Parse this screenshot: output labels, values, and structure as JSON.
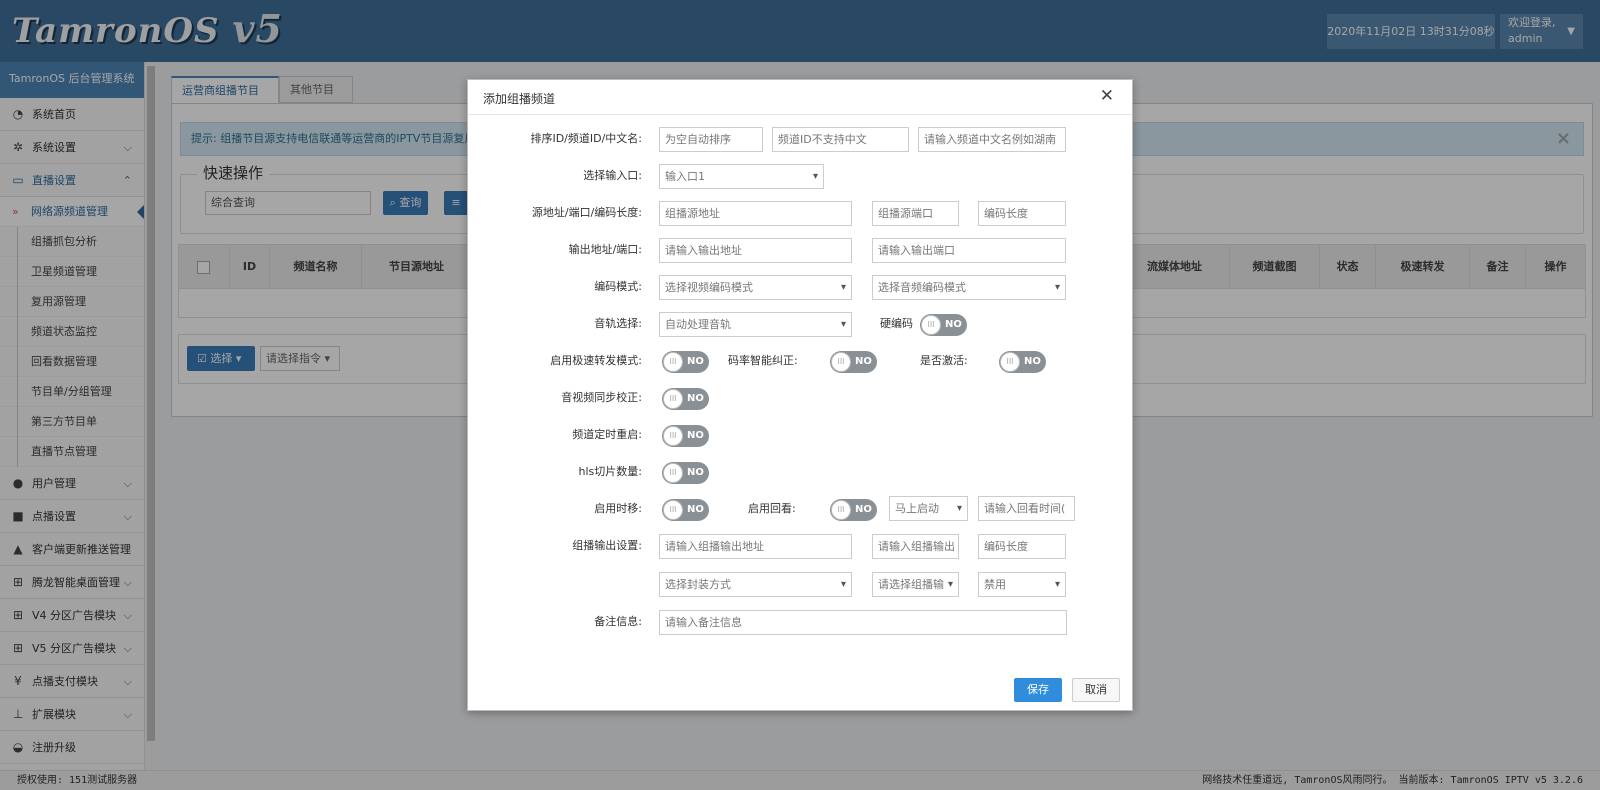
{
  "header": {
    "logo_text": "TamronOS",
    "logo_version": "v5",
    "datetime": "2020年11月02日 13时31分08秒",
    "welcome": "欢迎登录,",
    "username": "admin"
  },
  "sidebar": {
    "title": "TamronOS 后台管理系统",
    "items": [
      {
        "label": "系统首页",
        "icon": "dashboard-icon"
      },
      {
        "label": "系统设置",
        "icon": "gears-icon"
      },
      {
        "label": "直播设置",
        "icon": "monitor-icon"
      },
      {
        "label": "用户管理",
        "icon": "user-icon"
      },
      {
        "label": "点播设置",
        "icon": "video-camera-icon"
      },
      {
        "label": "客户端更新推送管理",
        "icon": "android-icon"
      },
      {
        "label": "腾龙智能桌面管理",
        "icon": "windows-icon"
      },
      {
        "label": "V4 分区广告模块",
        "icon": "windows-icon"
      },
      {
        "label": "V5 分区广告模块",
        "icon": "windows-icon"
      },
      {
        "label": "点播支付模块",
        "icon": "yen-icon"
      },
      {
        "label": "扩展模块",
        "icon": "sitemap-icon"
      },
      {
        "label": "注册升级",
        "icon": "tachometer-icon"
      }
    ],
    "subitems": [
      "网络源频道管理",
      "组播抓包分析",
      "卫星频道管理",
      "复用源管理",
      "频道状态监控",
      "回看数据管理",
      "节目单/分组管理",
      "第三方节目单",
      "直播节点管理"
    ]
  },
  "main": {
    "tabs": [
      "运营商组播节目源",
      "其他节目源"
    ],
    "tip": "提示: 组播节目源支持电信联通等运营商的IPTV节目源复用",
    "quick_title": "快速操作",
    "search_value": "综合查询",
    "search_btn": "查询",
    "table_headers_left": [
      "ID",
      "频道名称",
      "节目源地址"
    ],
    "table_headers_right": [
      "流媒体地址",
      "频道截图",
      "状态",
      "极速转发",
      "备注",
      "操作"
    ],
    "select_btn": "选择",
    "command_placeholder": "请选择指令"
  },
  "modal": {
    "title": "添加组播频道",
    "labels": {
      "sort": "排序ID/频道ID/中文名:",
      "input_port": "选择输入口:",
      "source": "源地址/端口/编码长度:",
      "output": "输出地址/端口:",
      "codec_mode": "编码模式:",
      "audio_track": "音轨选择:",
      "hard_codec": "硬编码",
      "fast_forward": "启用极速转发模式:",
      "bitrate_fix": "码率智能纠正:",
      "activate": "是否激活:",
      "av_sync": "音视频同步校正:",
      "timed_restart": "频道定时重启:",
      "hls_count": "hls切片数量:",
      "timeshift": "启用时移:",
      "playback": "启用回看:",
      "multicast_out": "组播输出设置:",
      "remark": "备注信息:"
    },
    "fields": {
      "sort_id": "为空自动排序",
      "channel_id": "频道ID不支持中文",
      "channel_name": "请输入频道中文名例如湖南",
      "input_port": "输入口1",
      "src_addr": "组播源地址",
      "src_port": "组播源端口",
      "src_codelen": "编码长度",
      "out_addr": "请输入输出地址",
      "out_port": "请输入输出端口",
      "video_codec": "选择视频编码模式",
      "audio_codec": "选择音频编码模式",
      "audio_track": "自动处理音轨",
      "playback_start": "马上启动",
      "playback_time": "请输入回看时间(",
      "mc_out_addr": "请输入组播输出地址",
      "mc_out_port": "请输入组播输出",
      "mc_codelen": "编码长度",
      "encap": "选择封装方式",
      "mc_select": "请选择组播输",
      "disable": "禁用",
      "remark": "请输入备注信息"
    },
    "toggle_off": "NO",
    "toggle_knob": "III",
    "save": "保存",
    "cancel": "取消"
  },
  "footer": {
    "left": "授权使用: 151测试服务器",
    "right": "网络技术任重道远, TamronOS风雨同行。 当前版本: TamronOS IPTV v5 3.2.6"
  }
}
